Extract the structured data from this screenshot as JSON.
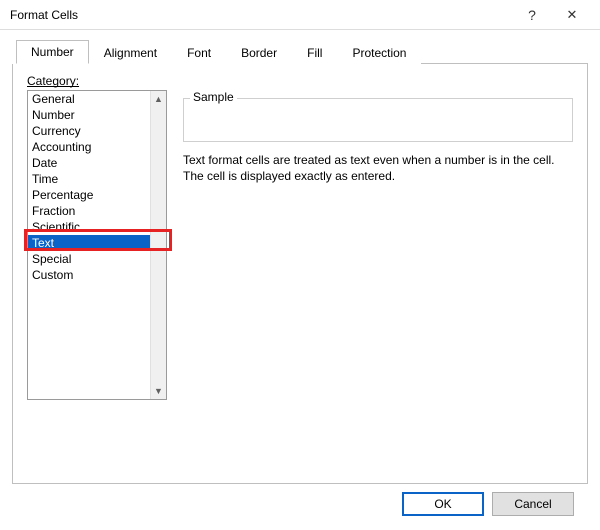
{
  "window": {
    "title": "Format Cells",
    "help_glyph": "?",
    "close_glyph": "✕"
  },
  "tabs": {
    "items": [
      {
        "label": "Number"
      },
      {
        "label": "Alignment"
      },
      {
        "label": "Font"
      },
      {
        "label": "Border"
      },
      {
        "label": "Fill"
      },
      {
        "label": "Protection"
      }
    ],
    "active_index": 0
  },
  "category": {
    "label": "Category:",
    "items": [
      "General",
      "Number",
      "Currency",
      "Accounting",
      "Date",
      "Time",
      "Percentage",
      "Fraction",
      "Scientific",
      "Text",
      "Special",
      "Custom"
    ],
    "selected_index": 9
  },
  "sample": {
    "label": "Sample",
    "value": ""
  },
  "description": "Text format cells are treated as text even when a number is in the cell. The cell is displayed exactly as entered.",
  "buttons": {
    "ok": "OK",
    "cancel": "Cancel"
  },
  "scroll": {
    "up_glyph": "▲",
    "down_glyph": "▼"
  }
}
